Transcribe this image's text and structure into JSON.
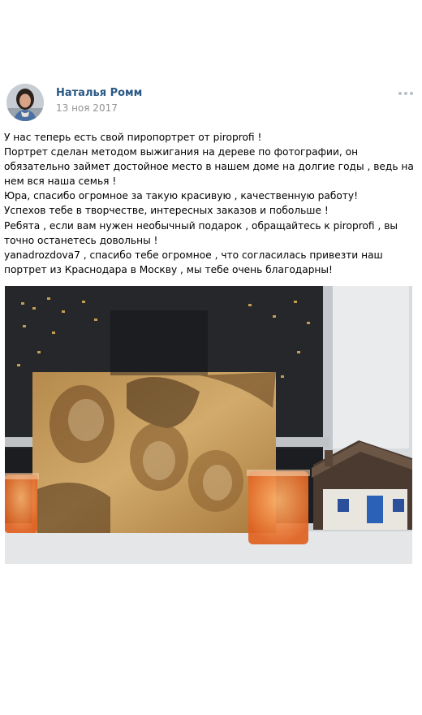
{
  "post": {
    "author": "Наталья Ромм",
    "date": "13 ноя 2017",
    "text_lines": [
      "У нас теперь есть свой пиропортрет от piroprofi !",
      "Портрет сделан методом выжигания на дереве по фотографии, он обязательно займет достойное место в нашем доме на долгие годы , ведь на нем вся наша семья !",
      "Юра, спасибо огромное за такую красивую , качественную работу!",
      "Успехов тебе в творчестве, интересных заказов и побольше !",
      "Ребята , если вам нужен необычный подарок , обращайтесь к piroprofi , вы точно останетесь довольны !",
      "yanadrozdova7 , спасибо тебе огромное , что согласилась привезти наш портрет из Краснодара в Москву , мы тебе очень благодарны!"
    ]
  },
  "icons": {
    "more": "more-horizontal-icon"
  },
  "colors": {
    "author_link": "#2a5885",
    "date": "#939393",
    "more_dots": "#b7bec6"
  }
}
